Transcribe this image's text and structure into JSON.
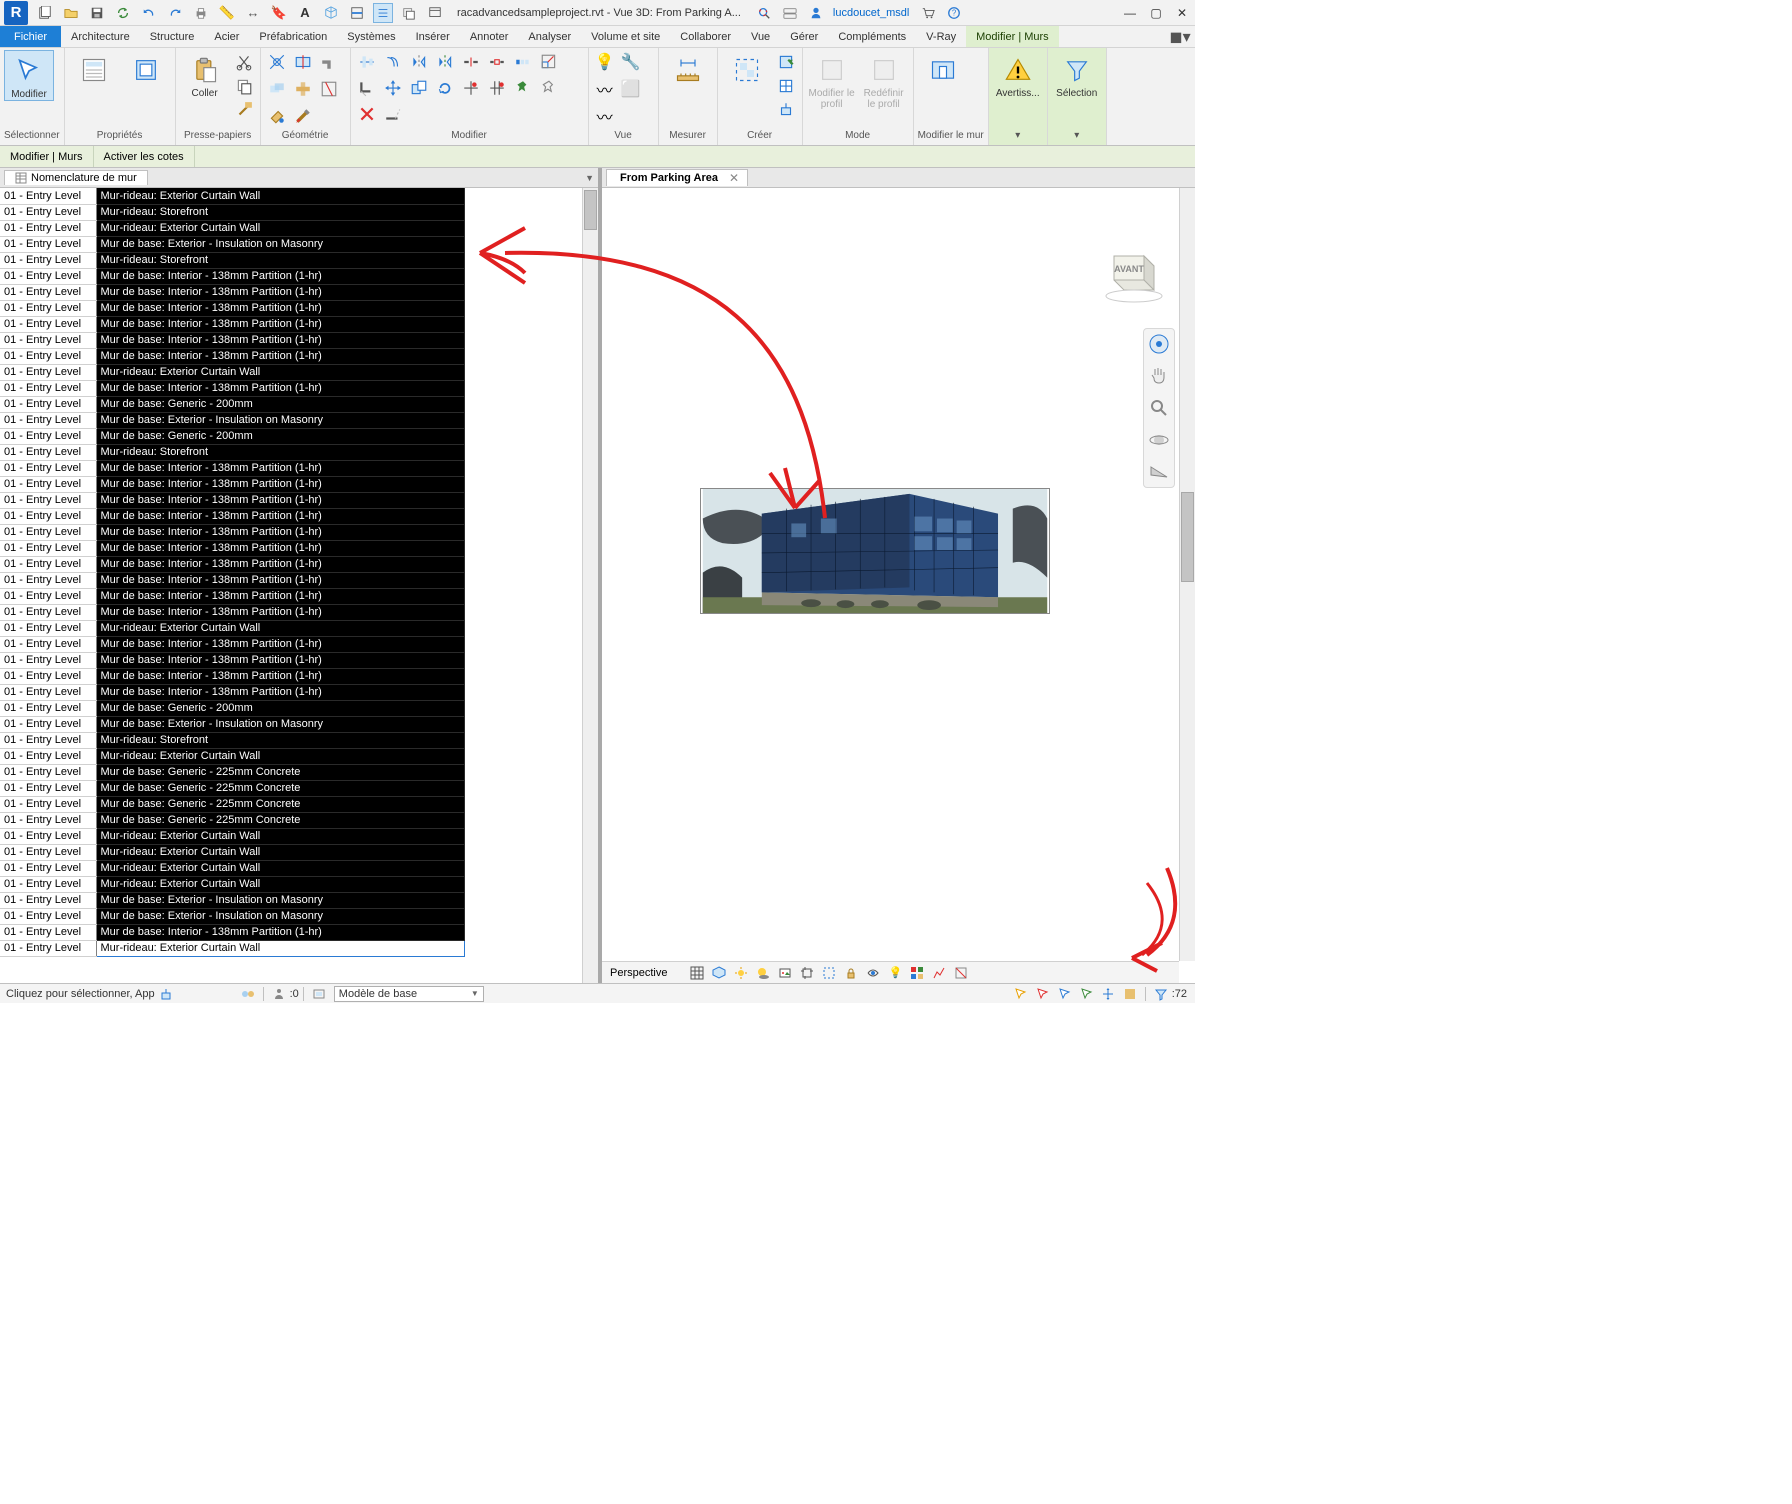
{
  "title": {
    "doc": "racadvancedsampleproject.rvt - Vue 3D: From Parking A...",
    "user": "lucdoucet_msdl"
  },
  "ribbon_tabs": [
    "Fichier",
    "Architecture",
    "Structure",
    "Acier",
    "Préfabrication",
    "Systèmes",
    "Insérer",
    "Annoter",
    "Analyser",
    "Volume et site",
    "Collaborer",
    "Vue",
    "Gérer",
    "Compléments",
    "V-Ray",
    "Modifier | Murs"
  ],
  "ribbon_panels": {
    "select": {
      "label": "Sélectionner",
      "btn": "Modifier"
    },
    "props": {
      "label": "Propriétés"
    },
    "clip": {
      "label": "Presse-papiers",
      "btn": "Coller"
    },
    "geom": {
      "label": "Géométrie"
    },
    "modify": {
      "label": "Modifier"
    },
    "view": {
      "label": "Vue"
    },
    "measure": {
      "label": "Mesurer"
    },
    "create": {
      "label": "Créer"
    },
    "mode": {
      "label": "Mode",
      "b1": "Modifier le profil",
      "b2": "Redéfinir le profil"
    },
    "modwall": {
      "label": "Modifier le mur"
    },
    "warn": {
      "label": "Avertiss..."
    },
    "sel2": {
      "label": "Sélection"
    }
  },
  "options_bar": {
    "a": "Modifier | Murs",
    "b": "Activer les cotes"
  },
  "schedule": {
    "title": "Nomenclature de mur",
    "rows": [
      [
        "01 - Entry Level",
        "Mur-rideau: Exterior Curtain Wall"
      ],
      [
        "01 - Entry Level",
        "Mur-rideau: Storefront"
      ],
      [
        "01 - Entry Level",
        "Mur-rideau: Exterior Curtain Wall"
      ],
      [
        "01 - Entry Level",
        "Mur de base: Exterior - Insulation on Masonry"
      ],
      [
        "01 - Entry Level",
        "Mur-rideau: Storefront"
      ],
      [
        "01 - Entry Level",
        "Mur de base: Interior - 138mm Partition (1-hr)"
      ],
      [
        "01 - Entry Level",
        "Mur de base: Interior - 138mm Partition (1-hr)"
      ],
      [
        "01 - Entry Level",
        "Mur de base: Interior - 138mm Partition (1-hr)"
      ],
      [
        "01 - Entry Level",
        "Mur de base: Interior - 138mm Partition (1-hr)"
      ],
      [
        "01 - Entry Level",
        "Mur de base: Interior - 138mm Partition (1-hr)"
      ],
      [
        "01 - Entry Level",
        "Mur de base: Interior - 138mm Partition (1-hr)"
      ],
      [
        "01 - Entry Level",
        "Mur-rideau: Exterior Curtain Wall"
      ],
      [
        "01 - Entry Level",
        "Mur de base: Interior - 138mm Partition (1-hr)"
      ],
      [
        "01 - Entry Level",
        "Mur de base: Generic - 200mm"
      ],
      [
        "01 - Entry Level",
        "Mur de base: Exterior - Insulation on Masonry"
      ],
      [
        "01 - Entry Level",
        "Mur de base: Generic - 200mm"
      ],
      [
        "01 - Entry Level",
        "Mur-rideau: Storefront"
      ],
      [
        "01 - Entry Level",
        "Mur de base: Interior - 138mm Partition (1-hr)"
      ],
      [
        "01 - Entry Level",
        "Mur de base: Interior - 138mm Partition (1-hr)"
      ],
      [
        "01 - Entry Level",
        "Mur de base: Interior - 138mm Partition (1-hr)"
      ],
      [
        "01 - Entry Level",
        "Mur de base: Interior - 138mm Partition (1-hr)"
      ],
      [
        "01 - Entry Level",
        "Mur de base: Interior - 138mm Partition (1-hr)"
      ],
      [
        "01 - Entry Level",
        "Mur de base: Interior - 138mm Partition (1-hr)"
      ],
      [
        "01 - Entry Level",
        "Mur de base: Interior - 138mm Partition (1-hr)"
      ],
      [
        "01 - Entry Level",
        "Mur de base: Interior - 138mm Partition (1-hr)"
      ],
      [
        "01 - Entry Level",
        "Mur de base: Interior - 138mm Partition (1-hr)"
      ],
      [
        "01 - Entry Level",
        "Mur de base: Interior - 138mm Partition (1-hr)"
      ],
      [
        "01 - Entry Level",
        "Mur-rideau: Exterior Curtain Wall"
      ],
      [
        "01 - Entry Level",
        "Mur de base: Interior - 138mm Partition (1-hr)"
      ],
      [
        "01 - Entry Level",
        "Mur de base: Interior - 138mm Partition (1-hr)"
      ],
      [
        "01 - Entry Level",
        "Mur de base: Interior - 138mm Partition (1-hr)"
      ],
      [
        "01 - Entry Level",
        "Mur de base: Interior - 138mm Partition (1-hr)"
      ],
      [
        "01 - Entry Level",
        "Mur de base: Generic - 200mm"
      ],
      [
        "01 - Entry Level",
        "Mur de base: Exterior - Insulation on Masonry"
      ],
      [
        "01 - Entry Level",
        "Mur-rideau: Storefront"
      ],
      [
        "01 - Entry Level",
        "Mur-rideau: Exterior Curtain Wall"
      ],
      [
        "01 - Entry Level",
        "Mur de base: Generic - 225mm Concrete"
      ],
      [
        "01 - Entry Level",
        "Mur de base: Generic - 225mm Concrete"
      ],
      [
        "01 - Entry Level",
        "Mur de base: Generic - 225mm Concrete"
      ],
      [
        "01 - Entry Level",
        "Mur de base: Generic - 225mm Concrete"
      ],
      [
        "01 - Entry Level",
        "Mur-rideau: Exterior Curtain Wall"
      ],
      [
        "01 - Entry Level",
        "Mur-rideau: Exterior Curtain Wall"
      ],
      [
        "01 - Entry Level",
        "Mur-rideau: Exterior Curtain Wall"
      ],
      [
        "01 - Entry Level",
        "Mur-rideau: Exterior Curtain Wall"
      ],
      [
        "01 - Entry Level",
        "Mur de base: Exterior - Insulation on Masonry"
      ],
      [
        "01 - Entry Level",
        "Mur de base: Exterior - Insulation on Masonry"
      ],
      [
        "01 - Entry Level",
        "Mur de base: Interior - 138mm Partition (1-hr)"
      ],
      [
        "01 - Entry Level",
        "Mur-rideau: Exterior Curtain Wall"
      ]
    ],
    "selected_row": 47
  },
  "view3d": {
    "tab_title": "From Parking Area",
    "ctrl_label": "Perspective",
    "cube_face": "AVANT"
  },
  "status_bar": {
    "msg": "Cliquez pour sélectionner, App",
    "count_label": ":0",
    "worksets": "Modèle de base",
    "filter_count": ":72"
  }
}
